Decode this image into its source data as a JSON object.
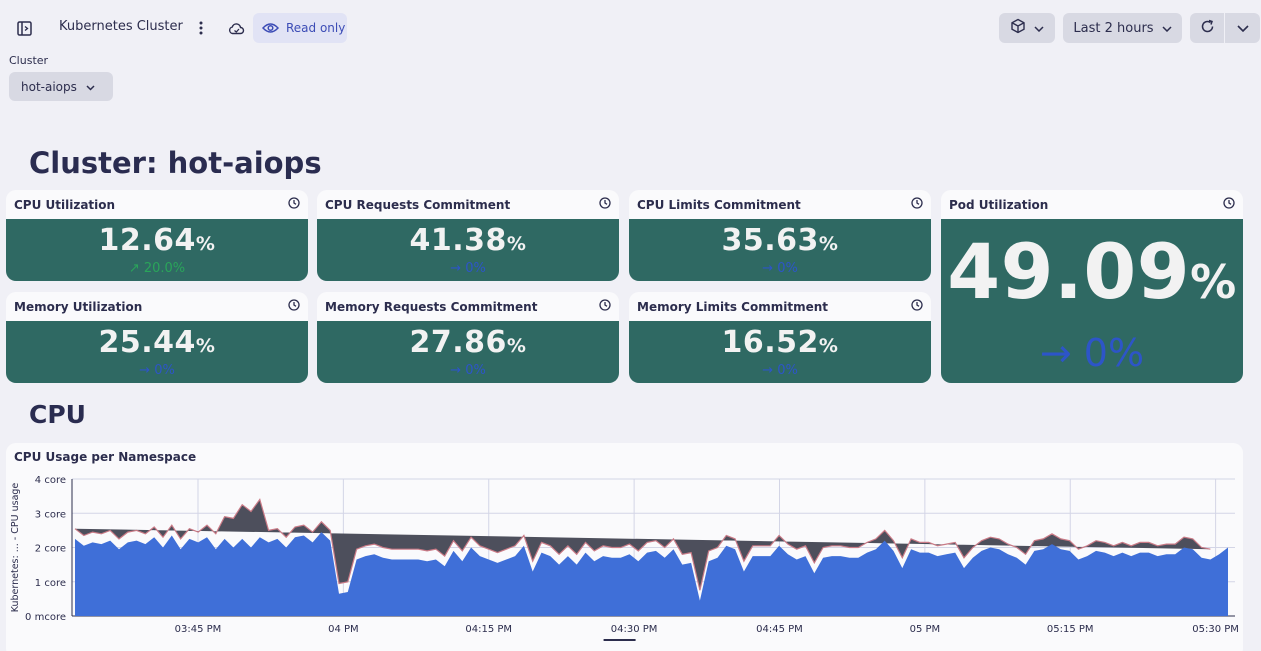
{
  "header": {
    "title": "Kubernetes Cluster",
    "readonly_label": "Read only",
    "timeframe_label": "Last 2 hours",
    "icons": [
      "sidebar-toggle-icon",
      "more-vertical-icon",
      "cloud-sync-icon",
      "eye-icon",
      "cube-icon",
      "chevron-down-icon",
      "refresh-icon"
    ]
  },
  "filters": {
    "cluster_label": "Cluster",
    "cluster_value": "hot-aiops"
  },
  "sections": {
    "cluster_heading": "Cluster: hot-aiops",
    "cpu_heading": "CPU"
  },
  "tiles": [
    {
      "title": "CPU Utilization",
      "value": "12.64",
      "unit": "%",
      "trend": "↗ 20.0%",
      "trend_dir": "up"
    },
    {
      "title": "CPU Requests Commitment",
      "value": "41.38",
      "unit": "%",
      "trend": "→ 0%",
      "trend_dir": "flat"
    },
    {
      "title": "CPU Limits Commitment",
      "value": "35.63",
      "unit": "%",
      "trend": "→ 0%",
      "trend_dir": "flat"
    },
    {
      "title": "Pod Utilization",
      "value": "49.09",
      "unit": "%",
      "trend": "→ 0%",
      "trend_dir": "flat"
    },
    {
      "title": "Memory Utilization",
      "value": "25.44",
      "unit": "%",
      "trend": "→ 0%",
      "trend_dir": "flat"
    },
    {
      "title": "Memory Requests Commitment",
      "value": "27.86",
      "unit": "%",
      "trend": "→ 0%",
      "trend_dir": "flat"
    },
    {
      "title": "Memory Limits Commitment",
      "value": "16.52",
      "unit": "%",
      "trend": "→ 0%",
      "trend_dir": "flat"
    }
  ],
  "colors": {
    "tile_bg": "#2f6963",
    "trend_flat": "#2d55c8",
    "trend_up": "#2aa55a",
    "series_main": "#3f6fd8",
    "series_other": "#4d4f5c"
  },
  "chart_data": {
    "type": "area",
    "title": "CPU Usage per Namespace",
    "ylabel": "Kubernetes: ... - CPU usage",
    "yticks": [
      "0 mcore",
      "1 core",
      "2 core",
      "3 core",
      "4 core"
    ],
    "ylim": [
      0,
      4
    ],
    "xticks": [
      "03:45 PM",
      "04 PM",
      "04:15 PM",
      "04:30 PM",
      "04:45 PM",
      "05 PM",
      "05:15 PM",
      "05:30 PM"
    ],
    "x_range_minutes": [
      -13,
      107
    ],
    "grid": true,
    "series": [
      {
        "values": [
          2.25,
          2.05,
          2.15,
          2.1,
          2.2,
          1.95,
          2.15,
          2.2,
          2.1,
          2.3,
          2.0,
          2.35,
          1.95,
          2.25,
          2.15,
          2.3,
          1.95,
          2.25,
          2.0,
          2.25,
          2.0,
          2.3,
          2.15,
          2.25,
          2.0,
          2.3,
          2.35,
          2.15,
          2.45,
          2.2,
          0.65,
          0.7,
          1.65,
          1.75,
          1.8,
          1.7,
          1.65,
          1.65,
          1.65,
          1.65,
          1.6,
          1.65,
          1.45,
          1.9,
          1.6,
          2.0,
          1.75,
          1.65,
          1.55,
          1.65,
          1.75,
          2.05,
          1.3,
          1.85,
          1.75,
          1.5,
          1.75,
          1.5,
          1.85,
          1.6,
          1.75,
          1.7,
          1.7,
          1.8,
          1.6,
          1.85,
          1.9,
          1.7,
          1.95,
          1.5,
          1.55,
          0.45,
          1.6,
          1.7,
          2.05,
          1.95,
          1.3,
          1.75,
          1.75,
          1.75,
          2.05,
          1.8,
          1.65,
          1.75,
          1.25,
          1.7,
          1.75,
          1.75,
          1.7,
          1.7,
          1.85,
          1.95,
          2.2,
          1.9,
          1.4,
          1.95,
          1.85,
          1.85,
          1.75,
          1.8,
          1.85,
          1.4,
          1.7,
          1.9,
          2.0,
          1.95,
          1.8,
          1.7,
          1.5,
          1.9,
          1.95,
          2.1,
          1.95,
          1.9,
          1.65,
          1.75,
          1.9,
          1.85,
          1.75,
          1.85,
          1.75,
          1.85,
          1.85,
          1.75,
          1.8,
          1.8,
          2.0,
          1.95,
          1.7,
          1.65,
          1.8,
          2.0
        ]
      },
      {
        "values": [
          0.3,
          0.3,
          0.3,
          0.3,
          0.3,
          0.3,
          0.3,
          0.3,
          0.3,
          0.3,
          0.3,
          0.3,
          0.3,
          0.3,
          0.3,
          0.35,
          0.45,
          0.65,
          0.85,
          1.0,
          1.05,
          1.1,
          0.35,
          0.3,
          0.3,
          0.3,
          0.3,
          0.3,
          0.3,
          0.3,
          0.3,
          0.3,
          0.3,
          0.3,
          0.3,
          0.3,
          0.3,
          0.3,
          0.3,
          0.3,
          0.3,
          0.3,
          0.3,
          0.3,
          0.3,
          0.3,
          0.3,
          0.3,
          0.3,
          0.3,
          0.3,
          0.3,
          0.3,
          0.3,
          0.3,
          0.3,
          0.3,
          0.3,
          0.3,
          0.3,
          0.3,
          0.3,
          0.3,
          0.3,
          0.3,
          0.3,
          0.3,
          0.3,
          0.3,
          0.3,
          0.3,
          0.3,
          0.3,
          0.3,
          0.3,
          0.3,
          0.3,
          0.3,
          0.3,
          0.3,
          0.3,
          0.3,
          0.3,
          0.3,
          0.3,
          0.3,
          0.3,
          0.3,
          0.3,
          0.3,
          0.3,
          0.3,
          0.3,
          0.3,
          0.3,
          0.3,
          0.3,
          0.3,
          0.3,
          0.3,
          0.3,
          0.3,
          0.3,
          0.3,
          0.3,
          0.3,
          0.3,
          0.3,
          0.3,
          0.3,
          0.3,
          0.3,
          0.3,
          0.3,
          0.3,
          0.3,
          0.3,
          0.3,
          0.3,
          0.3,
          0.3,
          0.3,
          0.3,
          0.3,
          0.3,
          0.3,
          0.3,
          0.3,
          0.3,
          0.3
        ]
      }
    ]
  }
}
